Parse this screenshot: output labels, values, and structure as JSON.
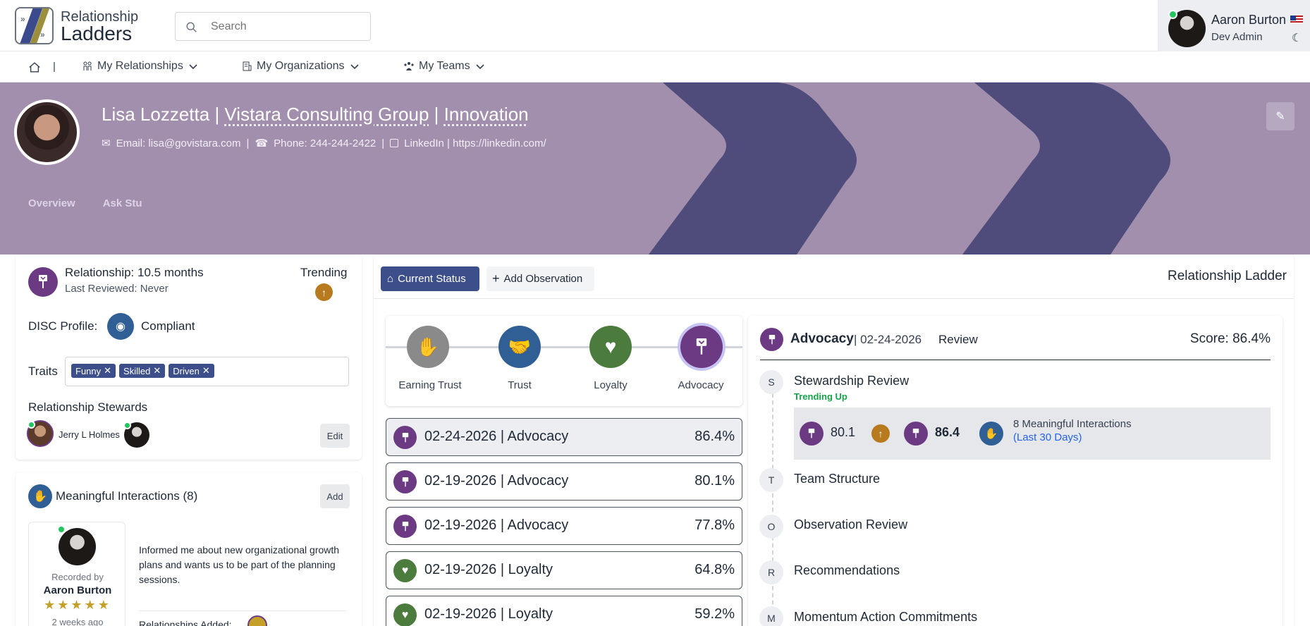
{
  "app": {
    "logo_line1": "Relationship",
    "logo_line2": "Ladders"
  },
  "search": {
    "placeholder": "Search"
  },
  "user": {
    "name": "Aaron Burton",
    "role": "Dev Admin"
  },
  "nav": {
    "items": [
      {
        "label": "My Relationships",
        "icon": "people-icon"
      },
      {
        "label": "My Organizations",
        "icon": "building-icon"
      },
      {
        "label": "My Teams",
        "icon": "team-icon"
      }
    ],
    "separator": "|"
  },
  "profile": {
    "name": "Lisa Lozzetta",
    "org": "Vistara Consulting Group",
    "dept": "Innovation",
    "sep": " | ",
    "email": "Email: lisa@govistara.com",
    "phone": "Phone: 244-244-2422",
    "linkedin": "LinkedIn | https://linkedin.com/",
    "pipe": "|",
    "tabs": [
      "Overview",
      "Ask Stu"
    ]
  },
  "relationship": {
    "duration": "Relationship: 10.5 months",
    "last_reviewed": "Last Reviewed: Never",
    "trending_label": "Trending",
    "disc_label": "DISC Profile:",
    "disc_value": "Compliant",
    "traits_label": "Traits",
    "traits": [
      "Funny",
      "Skilled",
      "Driven"
    ],
    "stewards_label": "Relationship Stewards",
    "steward_name": "Jerry L Holmes",
    "edit_label": "Edit"
  },
  "interactions": {
    "title": "Meaningful Interactions (8)",
    "add_label": "Add",
    "recorded_by_label": "Recorded by",
    "recorder": "Aaron Burton",
    "stars": 5,
    "time_ago": "2 weeks ago",
    "text": "Informed me about new organizational growth plans and wants us to be part of the planning sessions.",
    "relationships_added": "Relationships Added:"
  },
  "main": {
    "current_status_label": "Current Status",
    "add_observation_label": "Add Observation",
    "ladder_label": "Relationship Ladder",
    "stages": [
      "Earning Trust",
      "Trust",
      "Loyalty",
      "Advocacy"
    ],
    "timeline": [
      {
        "date": "02-24-2026",
        "stage": "| Advocacy",
        "pct": "86.4%",
        "type": "advocacy"
      },
      {
        "date": "02-19-2026",
        "stage": "| Advocacy",
        "pct": "80.1%",
        "type": "advocacy"
      },
      {
        "date": "02-19-2026",
        "stage": "| Advocacy",
        "pct": "77.8%",
        "type": "advocacy"
      },
      {
        "date": "02-19-2026",
        "stage": "| Loyalty",
        "pct": "64.8%",
        "type": "loyalty"
      },
      {
        "date": "02-19-2026",
        "stage": "| Loyalty",
        "pct": "59.2%",
        "type": "loyalty"
      }
    ],
    "detail": {
      "stage": "Advocacy",
      "date": "| 02-24-2026",
      "review": "Review",
      "score": "Score: 86.4%",
      "story": [
        {
          "letter": "S",
          "title": "Stewardship Review"
        },
        {
          "letter": "T",
          "title": "Team Structure"
        },
        {
          "letter": "O",
          "title": "Observation Review"
        },
        {
          "letter": "R",
          "title": "Recommendations"
        },
        {
          "letter": "M",
          "title": "Momentum Action Commitments"
        }
      ],
      "trending": "Trending Up",
      "score_from": "80.1",
      "score_to": "86.4",
      "interactions": "8 Meaningful Interactions",
      "interactions_period": "(Last 30 Days)"
    }
  },
  "colors": {
    "purple": "#6b3a82",
    "blue": "#2f5f94",
    "green": "#4b7b3d",
    "banner": "#a28fae",
    "chevron": "#4f4c7c",
    "nav_btn": "#3c4f8a"
  }
}
